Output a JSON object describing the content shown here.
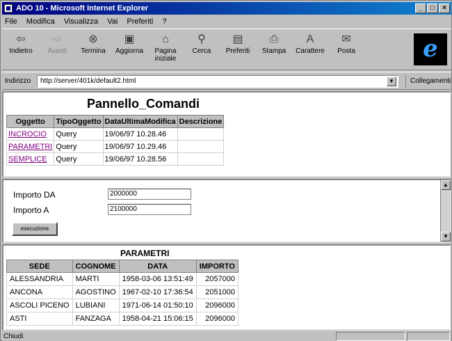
{
  "window": {
    "title": "ADO 10 - Microsoft Internet Explorer"
  },
  "menubar": {
    "items": [
      "File",
      "Modifica",
      "Visualizza",
      "Vai",
      "Preferiti",
      "?"
    ]
  },
  "toolbar": {
    "buttons": [
      {
        "label": "Indietro",
        "icon": "back-arrow-icon"
      },
      {
        "label": "Avanti",
        "icon": "forward-arrow-icon"
      },
      {
        "label": "Termina",
        "icon": "stop-icon"
      },
      {
        "label": "Aggiorna",
        "icon": "refresh-icon"
      },
      {
        "label": "Pagina iniziale",
        "icon": "home-icon"
      },
      {
        "label": "Cerca",
        "icon": "search-icon"
      },
      {
        "label": "Preferiti",
        "icon": "favorites-icon"
      },
      {
        "label": "Stampa",
        "icon": "print-icon"
      },
      {
        "label": "Carattere",
        "icon": "font-icon"
      },
      {
        "label": "Posta",
        "icon": "mail-icon"
      }
    ],
    "logo": "e"
  },
  "address": {
    "label": "Indirizzo",
    "value": "http://server/401k/default2.html",
    "links_label": "Collegamenti"
  },
  "panel1": {
    "title": "Pannello_Comandi",
    "headers": [
      "Oggetto",
      "TipoOggetto",
      "DataUltimaModifica",
      "Descrizione"
    ],
    "rows": [
      [
        "INCROCIO",
        "Query",
        "19/06/97 10.28.46",
        ""
      ],
      [
        "PARAMETRI",
        "Query",
        "19/06/97 10.29.46",
        ""
      ],
      [
        "SEMPLICE",
        "Query",
        "19/06/97 10.28.56",
        ""
      ]
    ]
  },
  "panel2": {
    "fields": [
      {
        "label": "Importo DA",
        "value": "2000000"
      },
      {
        "label": "Importo A",
        "value": "2100000"
      }
    ],
    "exec_label": "esecuzione"
  },
  "panel3": {
    "title": "PARAMETRI",
    "headers": [
      "SEDE",
      "COGNOME",
      "DATA",
      "IMPORTO"
    ],
    "rows": [
      [
        "ALESSANDRIA",
        "MARTI",
        "1958-03-06 13:51:49",
        "2057000"
      ],
      [
        "ANCONA",
        "AGOSTINO",
        "1967-02-10 17:36:54",
        "2051000"
      ],
      [
        "ASCOLI PICENO",
        "LUBIANI",
        "1971-06-14 01:50:10",
        "2096000"
      ],
      [
        "ASTI",
        "FANZAGA",
        "1958-04-21 15:06:15",
        "2096000"
      ]
    ]
  },
  "status": {
    "text": "Chiudi"
  }
}
